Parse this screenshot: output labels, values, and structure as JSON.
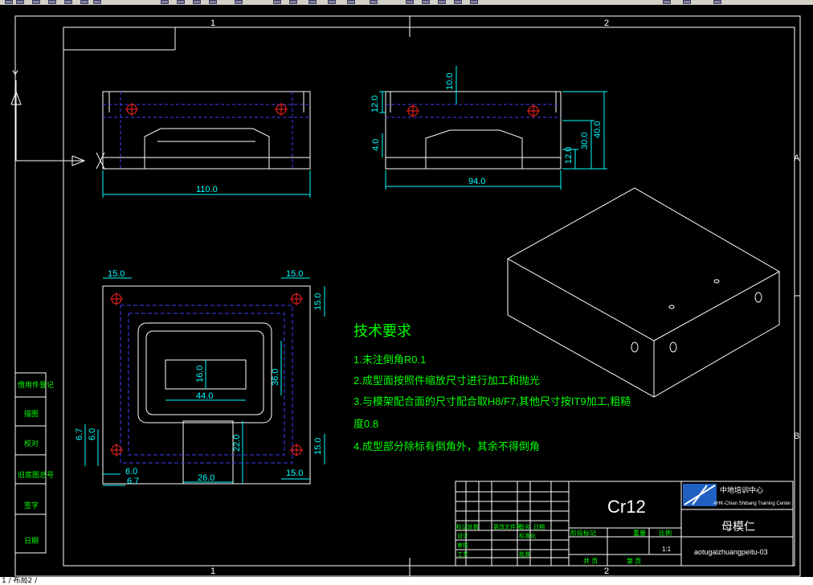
{
  "app": {
    "status_text": "1 / 布局2 /"
  },
  "frame": {
    "zone_top_1": "1",
    "zone_top_2": "2",
    "zone_bottom_1": "1",
    "zone_bottom_2": "2",
    "zone_right_a": "A",
    "zone_right_b": "B"
  },
  "ucs": {
    "y_label": "Y",
    "x_label": "X"
  },
  "dims": {
    "top_left_width": "110.0",
    "top_right_width": "94.0",
    "top_right_12a": "12.0",
    "top_right_10": "10.0",
    "top_right_4": "4.0",
    "top_right_30": "30.0",
    "top_right_40": "40.0",
    "top_right_12b": "12.0",
    "plan_15_tl": "15.0",
    "plan_15_tr": "15.0",
    "plan_15_r1": "15.0",
    "plan_16": "16.0",
    "plan_44": "44.0",
    "plan_36": "36.0",
    "plan_22": "22.0",
    "plan_67_left": "6.7",
    "plan_60_left": "6.0",
    "plan_60_bottom": "6.0",
    "plan_67_bottom": "6.7",
    "plan_26": "26.0",
    "plan_15_br": "15.0",
    "plan_15_r2": "15.0"
  },
  "tech": {
    "title": "技术要求",
    "line1": "1.未注倒角R0.1",
    "line2": "2.成型面按照件缩放尺寸进行加工和抛光",
    "line3": "3.与模架配合面的尺寸配合取H8/F7,其他尺寸按IT9加工,粗糙",
    "line3b": "度0.8",
    "line4": "4.成型部分除标有倒角外，其余不得倒角"
  },
  "side_table": {
    "r1": "借用件登记",
    "r2": "描图",
    "r3": "校对",
    "r4": "旧底图总号",
    "r5": "签字",
    "r6": "日期"
  },
  "title_block": {
    "material": "Cr12",
    "org_cn": "中地培训中心",
    "org_en": "AHK-Chian Shibang Training Center",
    "part_name": "母模仁",
    "drawing_no": "aotugaizhuangpeitu-03",
    "scale": "1:1",
    "h_stage": "阶段标记",
    "h_weight": "重量",
    "h_ratio": "比例",
    "h_sheet": "共  页",
    "h_page": "第  页",
    "c1": "标记",
    "c2": "处数",
    "c3": "更改文件号",
    "c4": "签名",
    "c5": "日期",
    "c6": "设计",
    "c7": "标准化",
    "c8": "审核",
    "c9": "工艺",
    "c10": "批准"
  },
  "colors": {
    "frame": "#ffffff",
    "dimension": "#00ffff",
    "hidden_line": "#4040ff",
    "text": "#00ff00",
    "center_mark": "#ff2020",
    "hatch_blue": "#2060c0"
  }
}
